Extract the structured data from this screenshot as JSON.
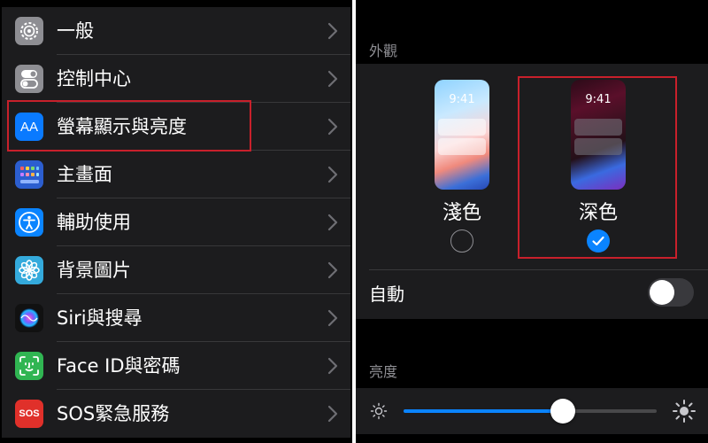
{
  "settings_list": {
    "items": [
      {
        "label": "一般",
        "icon": "gear-icon",
        "color": "#8e8e93"
      },
      {
        "label": "控制中心",
        "icon": "toggles-icon",
        "color": "#8e8e93"
      },
      {
        "label": "螢幕顯示與亮度",
        "icon": "text-size-icon",
        "color": "#0a7aff",
        "glyph": "AA"
      },
      {
        "label": "主畫面",
        "icon": "home-grid-icon",
        "color": "#2c5ecf"
      },
      {
        "label": "輔助使用",
        "icon": "accessibility-icon",
        "color": "#0a84ff"
      },
      {
        "label": "背景圖片",
        "icon": "flower-icon",
        "color": "#34aadc"
      },
      {
        "label": "Siri與搜尋",
        "icon": "siri-icon",
        "color": "#111111"
      },
      {
        "label": "Face ID與密碼",
        "icon": "face-id-icon",
        "color": "#30b552"
      },
      {
        "label": "SOS緊急服務",
        "icon": "sos-icon",
        "color": "#e0302a",
        "glyph": "SOS"
      }
    ],
    "highlighted_index": 2
  },
  "appearance": {
    "header": "外觀",
    "options": [
      {
        "label": "淺色",
        "time": "9:41",
        "selected": false
      },
      {
        "label": "深色",
        "time": "9:41",
        "selected": true
      }
    ],
    "automatic": {
      "label": "自動",
      "on": false
    }
  },
  "brightness": {
    "header": "亮度",
    "level": 0.63
  },
  "colors": {
    "accent": "#0a84ff",
    "highlight_box": "#c8202b",
    "cell_background": "#1c1c1e"
  }
}
